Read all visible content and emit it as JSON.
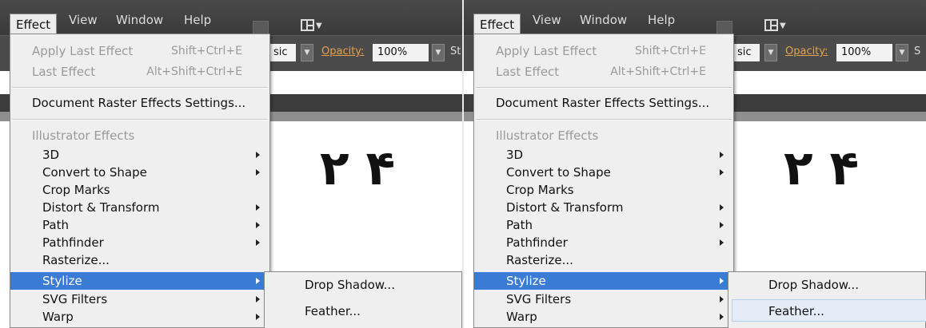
{
  "menubar": {
    "items": [
      "Effect",
      "View",
      "Window",
      "Help"
    ]
  },
  "options": {
    "style_value": "sic",
    "opacity_label": "Opacity:",
    "opacity_value": "100%",
    "style_label_left": "St",
    "style_label_right": "S"
  },
  "canvas": {
    "text": "۴ ۲"
  },
  "effect_menu": {
    "apply_last": {
      "label": "Apply Last Effect",
      "shortcut": "Shift+Ctrl+E"
    },
    "last_effect": {
      "label": "Last Effect",
      "shortcut": "Alt+Shift+Ctrl+E"
    },
    "doc_raster": "Document Raster Effects Settings...",
    "section_header": "Illustrator Effects",
    "items": [
      "3D",
      "Convert to Shape",
      "Crop Marks",
      "Distort & Transform",
      "Path",
      "Pathfinder",
      "Rasterize...",
      "Stylize",
      "SVG Filters",
      "Warp"
    ]
  },
  "stylize_submenu": {
    "items": [
      "Drop Shadow...",
      "Feather..."
    ]
  },
  "colors": {
    "highlight": "#3a7bd5",
    "menubar": "#404040",
    "opacity_label": "#e2a14a"
  }
}
